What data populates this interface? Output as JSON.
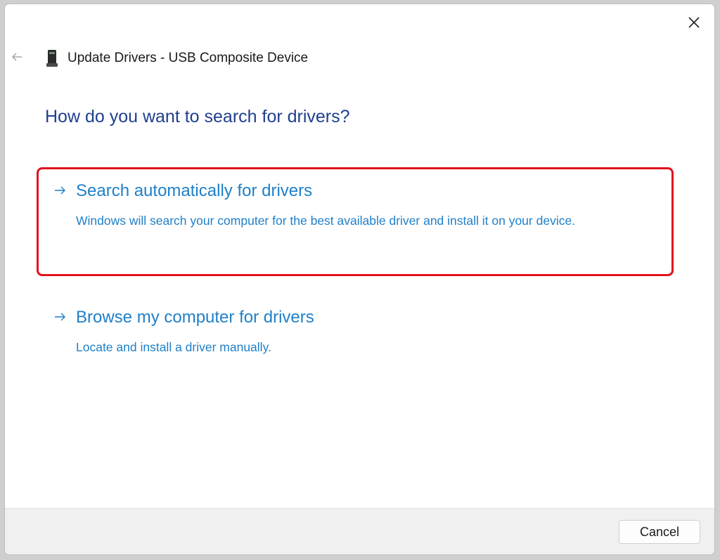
{
  "window": {
    "title": "Update Drivers - USB Composite Device",
    "close_icon": "close-icon",
    "back_icon": "back-arrow-icon",
    "device_icon": "usb-device-icon"
  },
  "main": {
    "heading": "How do you want to search for drivers?",
    "options": [
      {
        "title": "Search automatically for drivers",
        "description": "Windows will search your computer for the best available driver and install it on your device.",
        "icon": "arrow-right-icon",
        "highlighted": true
      },
      {
        "title": "Browse my computer for drivers",
        "description": "Locate and install a driver manually.",
        "icon": "arrow-right-icon",
        "highlighted": false
      }
    ]
  },
  "footer": {
    "cancel_label": "Cancel"
  },
  "colors": {
    "heading": "#1f3f8f",
    "link": "#1f7fc8",
    "highlight_border": "#e2121b",
    "footer_bg": "#f0f0f0"
  }
}
